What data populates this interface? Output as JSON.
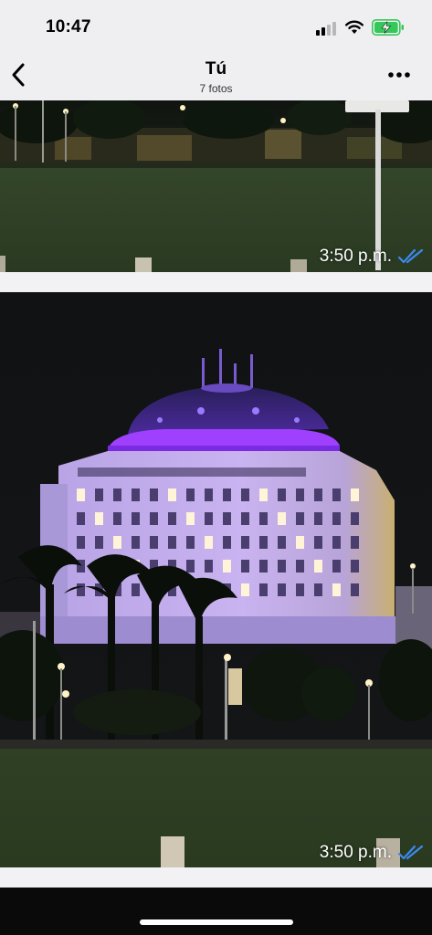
{
  "status": {
    "time": "10:47"
  },
  "header": {
    "title": "Tú",
    "subtitle": "7 fotos"
  },
  "photos": [
    {
      "time": "3:50 p.m.",
      "read_color": "#3b8af0"
    },
    {
      "time": "3:50 p.m.",
      "read_color": "#3b8af0"
    }
  ],
  "icons": {
    "back": "chevron-left",
    "more": "ellipsis",
    "signal": "cellular-signal",
    "wifi": "wifi",
    "battery": "battery-charging",
    "read": "double-check"
  },
  "colors": {
    "battery_fill": "#34c759",
    "building_glow": "#8b3cff"
  }
}
